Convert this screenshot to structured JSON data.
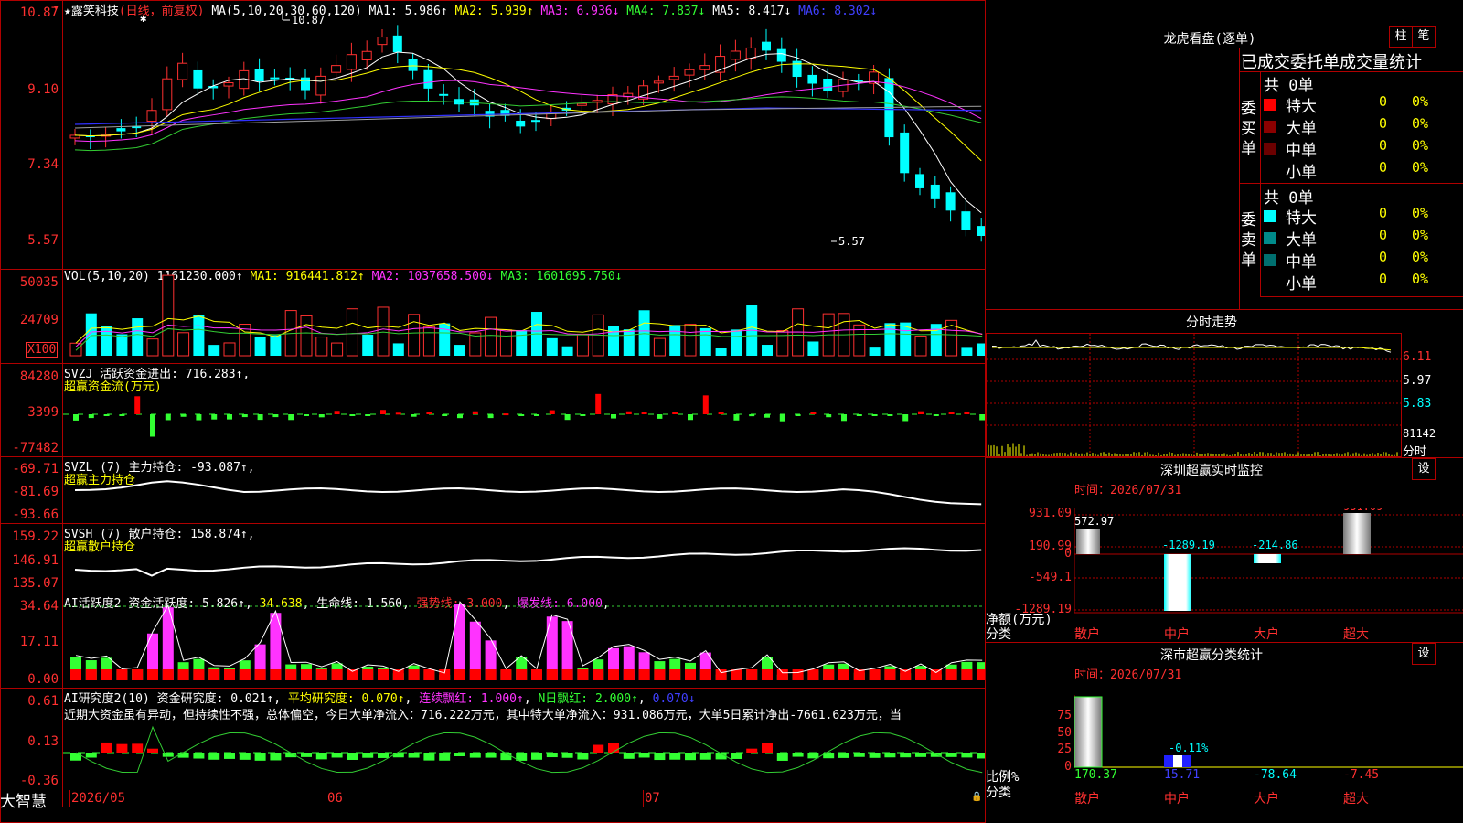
{
  "stock": {
    "name": "★露笑科技",
    "mode": "(日线，前复权)"
  },
  "ma_header": {
    "label": "MA(5,10,20,30,60,120)",
    "ma1": "MA1: 5.986↑",
    "ma2": "MA2: 5.939↑",
    "ma3": "MA3: 6.936↓",
    "ma4": "MA4: 7.837↓",
    "ma5": "MA5: 8.417↓",
    "ma6": "MA6: 8.302↓"
  },
  "price_axis": [
    "10.87",
    "9.10",
    "7.34",
    "5.57"
  ],
  "price_marks": {
    "high": "10.87",
    "low": "5.57"
  },
  "vol_header": {
    "label": "VOL(5,10,20)",
    "value": "1161230.000↑",
    "ma1": "MA1: 916441.812↑",
    "ma2": "MA2: 1037658.500↓",
    "ma3": "MA3: 1601695.750↓"
  },
  "vol_axis": [
    "50035",
    "24709"
  ],
  "vol_unit": "X100",
  "svzj": {
    "label": "SVZJ",
    "value_text": "活跃资金进出: 716.283↑,",
    "sub": "超赢资金流(万元)",
    "axis": [
      "84280",
      "3399",
      "-77482"
    ]
  },
  "svzl": {
    "label": "SVZL (7)",
    "value_text": "主力持仓: -93.087↑,",
    "sub": "超赢主力持仓",
    "axis": [
      "-69.71",
      "-81.69",
      "-93.66"
    ]
  },
  "svsh": {
    "label": "SVSH (7)",
    "value_text": "散户持仓: 158.874↑,",
    "sub": "超赢散户持仓",
    "axis": [
      "159.22",
      "146.91",
      "135.07"
    ]
  },
  "ai_active": {
    "label": "AI活跃度2",
    "v1": "资金活跃度: 5.826↑",
    "v2": "34.638",
    "v3": "生命线: 1.560",
    "v4": "强势线: 3.000",
    "v5": "爆发线: 6.000",
    "axis": [
      "34.64",
      "17.11",
      "0.00"
    ]
  },
  "ai_research": {
    "label": "AI研究度2(10)",
    "v1": "资金研究度: 0.021↑",
    "v2": "平均研究度: 0.070↑",
    "v3": "连续飘红: 1.000↑",
    "v4": "N日飘红: 2.000↑",
    "v5": "0.070↓",
    "axis": [
      "0.61",
      "0.13",
      "-0.36"
    ],
    "comment": "近期大资金虽有异动，但持续性不强，总体偏空，今日大单净流入：716.222万元，其中特大单净流入：931.086万元，大单5日累计净出-7661.623万元，当"
  },
  "date_axis": [
    "2026/05",
    "06",
    "07"
  ],
  "brand": "大智慧",
  "right": {
    "top_title": "龙虎看盘(逐单)",
    "btn_col": "柱",
    "btn_pen": "笔",
    "stat_title": "已成交委托单成交量统计",
    "buy_label": "委买单",
    "sell_label": "委卖单",
    "buy_total": "共 0单",
    "sell_total": "共 0单",
    "buy_rows": [
      {
        "name": "特大",
        "count": "0",
        "pct": "0%",
        "color": "#ff0000"
      },
      {
        "name": "大单",
        "count": "0",
        "pct": "0%",
        "color": "#8b0000"
      },
      {
        "name": "中单",
        "count": "0",
        "pct": "0%",
        "color": "#6b0000"
      },
      {
        "name": "小单",
        "count": "0",
        "pct": "0%",
        "color": ""
      }
    ],
    "sell_rows": [
      {
        "name": "特大",
        "count": "0",
        "pct": "0%",
        "color": "#00ffff"
      },
      {
        "name": "大单",
        "count": "0",
        "pct": "0%",
        "color": "#008b8b"
      },
      {
        "name": "中单",
        "count": "0",
        "pct": "0%",
        "color": "#007070"
      },
      {
        "name": "小单",
        "count": "0",
        "pct": "0%",
        "color": ""
      }
    ],
    "intraday_title": "分时走势",
    "intraday_axis": [
      "6.11",
      "5.97",
      "5.83",
      "81142"
    ],
    "intraday_unit": "分时",
    "monitor_title": "深圳超赢实时监控",
    "monitor_time": "时间：2026/07/31",
    "monitor_axis": [
      "931.09",
      "190.99",
      "0",
      "-549.1",
      "-1289.19"
    ],
    "monitor_ylabel": "净额(万元)",
    "monitor_xlabel": "分类",
    "monitor_values": [
      "572.97",
      "-1289.19",
      "-214.86",
      "931.09"
    ],
    "categories": [
      "散户",
      "中户",
      "大户",
      "超大"
    ],
    "classify_title": "深市超赢分类统计",
    "classify_time": "时间：2026/07/31",
    "classify_axis": [
      "75",
      "50",
      "25",
      "0"
    ],
    "classify_ylabel": "比例%",
    "classify_xlabel": "分类",
    "classify_values": [
      "170.37",
      "15.71",
      "-78.64",
      "-7.45"
    ],
    "classify_mark": "-0.11%",
    "settings": "设"
  },
  "colors": {
    "up": "#ff3030",
    "down": "#00ffff",
    "frame": "#b00000"
  }
}
